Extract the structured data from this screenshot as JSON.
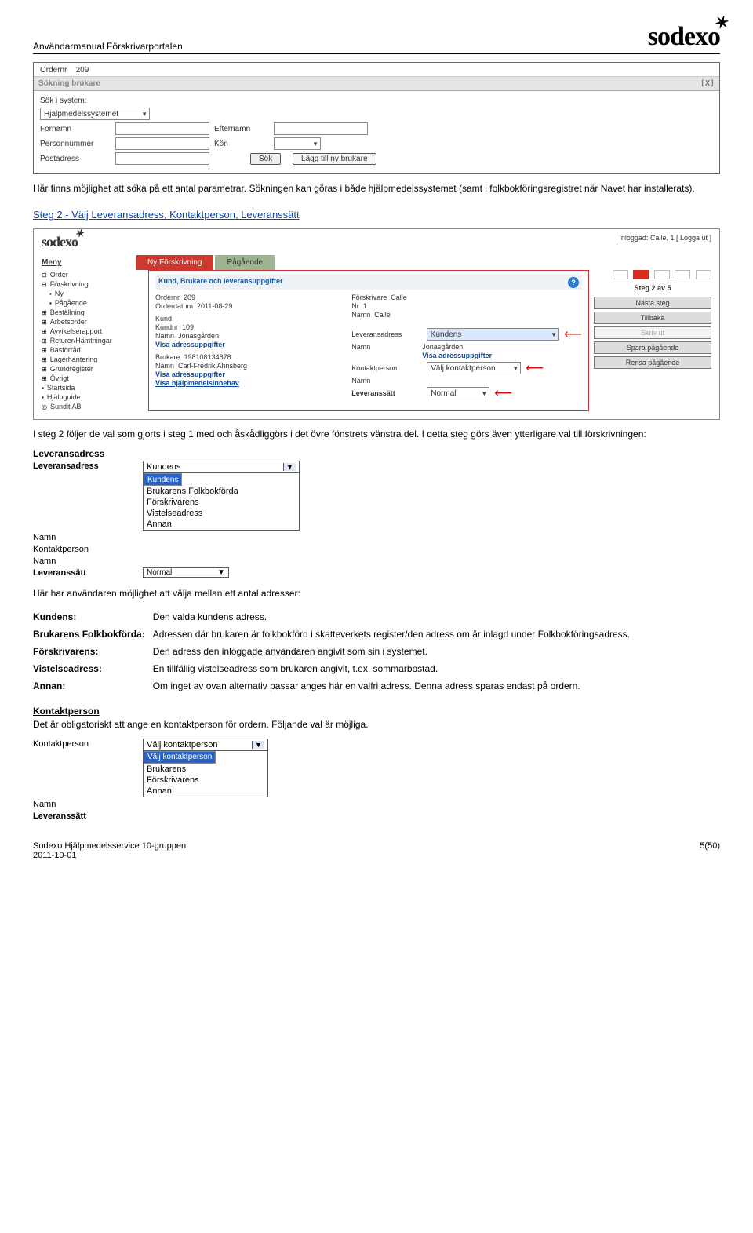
{
  "doc": {
    "header_title": "Användarmanual Förskrivarportalen",
    "logo_text": "sodexo",
    "footer_left_line1": "Sodexo Hjälpmedelsservice 10-gruppen",
    "footer_left_line2": "2011-10-01",
    "footer_right": "5(50)"
  },
  "search_panel": {
    "order_label": "Ordernr",
    "order_value": "209",
    "title": "Sökning brukare",
    "close": "[X]",
    "system_label": "Sök i system:",
    "system_value": "Hjälpmedelssystemet",
    "fn_label": "Förnamn",
    "ln_label": "Efternamn",
    "pn_label": "Personnummer",
    "kon_label": "Kön",
    "addr_label": "Postadress",
    "search_btn": "Sök",
    "add_btn": "Lägg till ny brukare"
  },
  "para1": "Här finns möjlighet att söka på ett antal parametrar. Sökningen kan göras i både hjälpmedelssystemet (samt i folkbokföringsregistret när Navet har installerats).",
  "step2_link": "Steg 2 - Välj Leveransadress, Kontaktperson, Leveranssätt",
  "step2_shot": {
    "login": "Inloggad: Calle, 1 [ Logga ut ]",
    "tab1": "Ny Förskrivning",
    "tab2": "Pågående",
    "menu_title": "Meny",
    "menu": [
      "Order",
      "Förskrivning",
      "Ny",
      "Pågående",
      "Beställning",
      "Arbetsorder",
      "Avvikelserapport",
      "Returer/Hämtningar",
      "Basförråd",
      "Lagerhantering",
      "Grundregister",
      "Övrigt",
      "Startsida",
      "Hjälpguide",
      "Sundit AB"
    ],
    "panel_title": "Kund, Brukare och leveransuppgifter",
    "ordernr_l": "Ordernr",
    "ordernr_v": "209",
    "orderdat_l": "Orderdatum",
    "orderdat_v": "2011-08-29",
    "kund_h": "Kund",
    "kundnr_l": "Kundnr",
    "kundnr_v": "109",
    "namn_l": "Namn",
    "namn_v": "Jonasgården",
    "visa_addr": "Visa adressuppgifter",
    "brukare_h": "Brukare",
    "brukare_namn": "Carl-Fredrik Ahnsberg",
    "brukare_pn": "198108134878",
    "visa_hjalp": "Visa hjälpmedelsinnehav",
    "forskrivare_l": "Förskrivare",
    "forskrivare_v": "Calle",
    "nr_l": "Nr",
    "nr_v": "1",
    "namn2_v": "Calle",
    "leveransadress_l": "Leveransadress",
    "leveransadress_v": "Kundens",
    "lev_namn_v": "Jonasgården",
    "kontaktperson_l": "Kontaktperson",
    "kontaktperson_v": "Välj kontaktperson",
    "leveranssatt_l": "Leveranssätt",
    "leveranssatt_v": "Normal",
    "step_text": "Steg 2 av 5",
    "btn_next": "Nästa steg",
    "btn_back": "Tillbaka",
    "btn_print": "Skriv ut",
    "btn_save": "Spara pågående",
    "btn_clear": "Rensa pågående"
  },
  "para2": "I steg 2 följer de val som gjorts i steg 1 med och åskådliggörs i det övre fönstrets vänstra del. I detta steg görs även ytterligare val till förskrivningen:",
  "section_leveransadress": "Leveransadress",
  "dd1": {
    "labels": {
      "lev": "Leveransadress",
      "namn": "Namn",
      "kp": "Kontaktperson",
      "namn2": "Namn",
      "ls": "Leveranssätt"
    },
    "selected": "Kundens",
    "options": [
      "Kundens",
      "Brukarens Folkbokförda",
      "Förskrivarens",
      "Vistelseadress",
      "Annan"
    ],
    "ls_value": "Normal"
  },
  "para3": "Här har användaren möjlighet att välja mellan ett antal adresser:",
  "defs": [
    {
      "k": "Kundens:",
      "v": "Den valda kundens adress."
    },
    {
      "k": "Brukarens Folkbokförda:",
      "v": "Adressen där brukaren är folkbokförd i skatteverkets register/den adress om är inlagd under Folkbokföringsadress."
    },
    {
      "k": "Förskrivarens:",
      "v": "Den adress den inloggade användaren angivit som sin i systemet."
    },
    {
      "k": "Vistelseadress:",
      "v": "En tillfällig vistelseadress som brukaren angivit, t.ex. sommarbostad."
    },
    {
      "k": "Annan:",
      "v": "Om inget av ovan alternativ passar anges här en valfri adress. Denna adress sparas endast på ordern."
    }
  ],
  "section_kontaktperson": "Kontaktperson",
  "para4": "Det är obligatoriskt att ange en kontaktperson för ordern. Följande val är möjliga.",
  "dd2": {
    "labels": {
      "kp": "Kontaktperson",
      "namn": "Namn",
      "ls": "Leveranssätt"
    },
    "selected": "Välj kontaktperson",
    "options": [
      "Välj kontaktperson",
      "Brukarens",
      "Förskrivarens",
      "Annan"
    ]
  }
}
